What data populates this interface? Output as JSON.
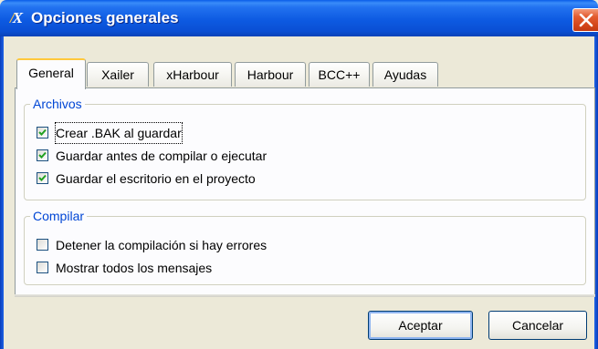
{
  "window": {
    "title": "Opciones generales",
    "icon": {
      "name": "app-icon",
      "glyph_a": "/",
      "glyph_b": "X"
    },
    "close_icon": "close-icon"
  },
  "tabs": [
    {
      "label": "General",
      "selected": true
    },
    {
      "label": "Xailer",
      "selected": false
    },
    {
      "label": "xHarbour",
      "selected": false
    },
    {
      "label": "Harbour",
      "selected": false
    },
    {
      "label": "BCC++",
      "selected": false
    },
    {
      "label": "Ayudas",
      "selected": false
    }
  ],
  "archivos": {
    "legend": "Archivos",
    "options": [
      {
        "label": "Crear .BAK al guardar",
        "checked": true
      },
      {
        "label": "Guardar antes de compilar o ejecutar",
        "checked": true
      },
      {
        "label": "Guardar el escritorio en el proyecto",
        "checked": true
      }
    ]
  },
  "compilar": {
    "legend": "Compilar",
    "options": [
      {
        "label": "Detener la compilación si hay errores",
        "checked": false
      },
      {
        "label": "Mostrar todos los mensajes",
        "checked": false
      }
    ]
  },
  "buttons": {
    "accept": "Aceptar",
    "cancel": "Cancelar"
  },
  "colors": {
    "titlebar": "#0a5de8",
    "legend": "#0046d5",
    "selected_tab_accent": "#ffc83c",
    "close_button": "#d34519"
  }
}
